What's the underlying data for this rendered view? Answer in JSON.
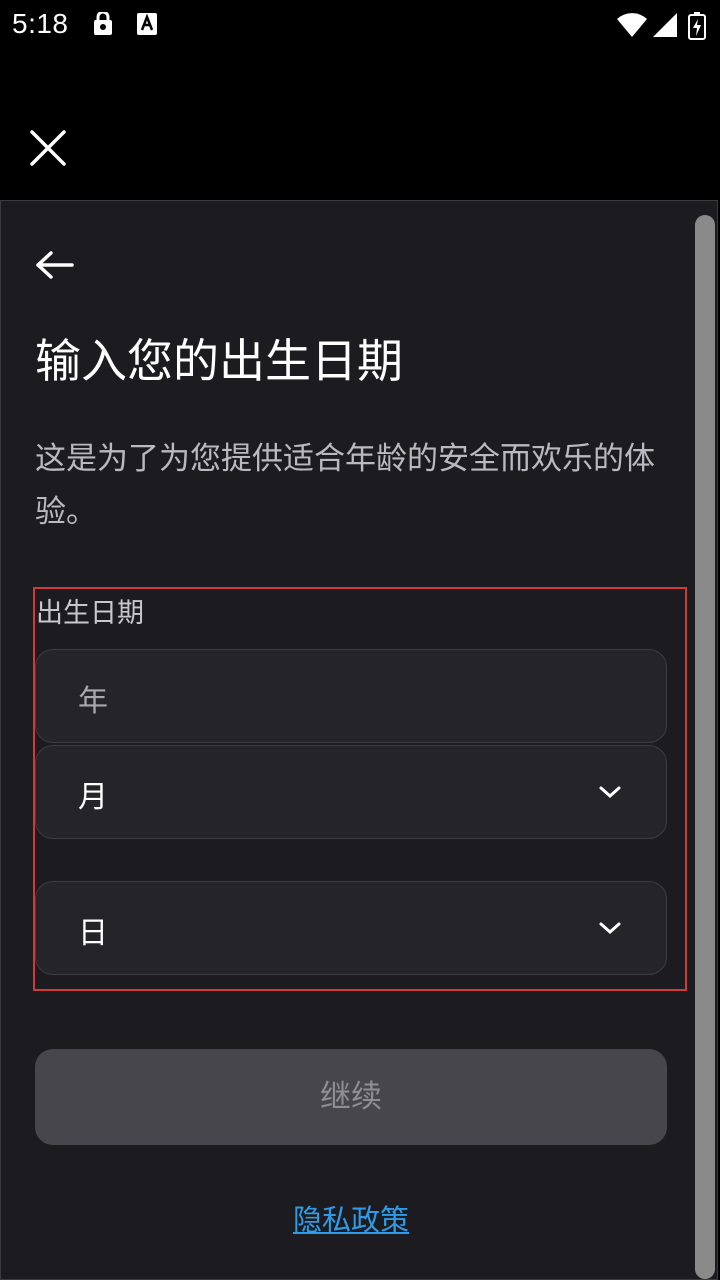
{
  "status_bar": {
    "time": "5:18"
  },
  "page": {
    "title": "输入您的出生日期",
    "subtitle": "这是为了为您提供适合年龄的安全而欢乐的体验。"
  },
  "birthdate": {
    "label": "出生日期",
    "year_placeholder": "年",
    "month_value": "月",
    "day_value": "日"
  },
  "actions": {
    "continue_label": "继续",
    "privacy_label": "隐私政策"
  },
  "colors": {
    "background": "#000000",
    "panel": "#1b1b20",
    "field": "#242429",
    "button_disabled": "#46464c",
    "link": "#2e9be8",
    "highlight_border": "#d23a3a"
  }
}
